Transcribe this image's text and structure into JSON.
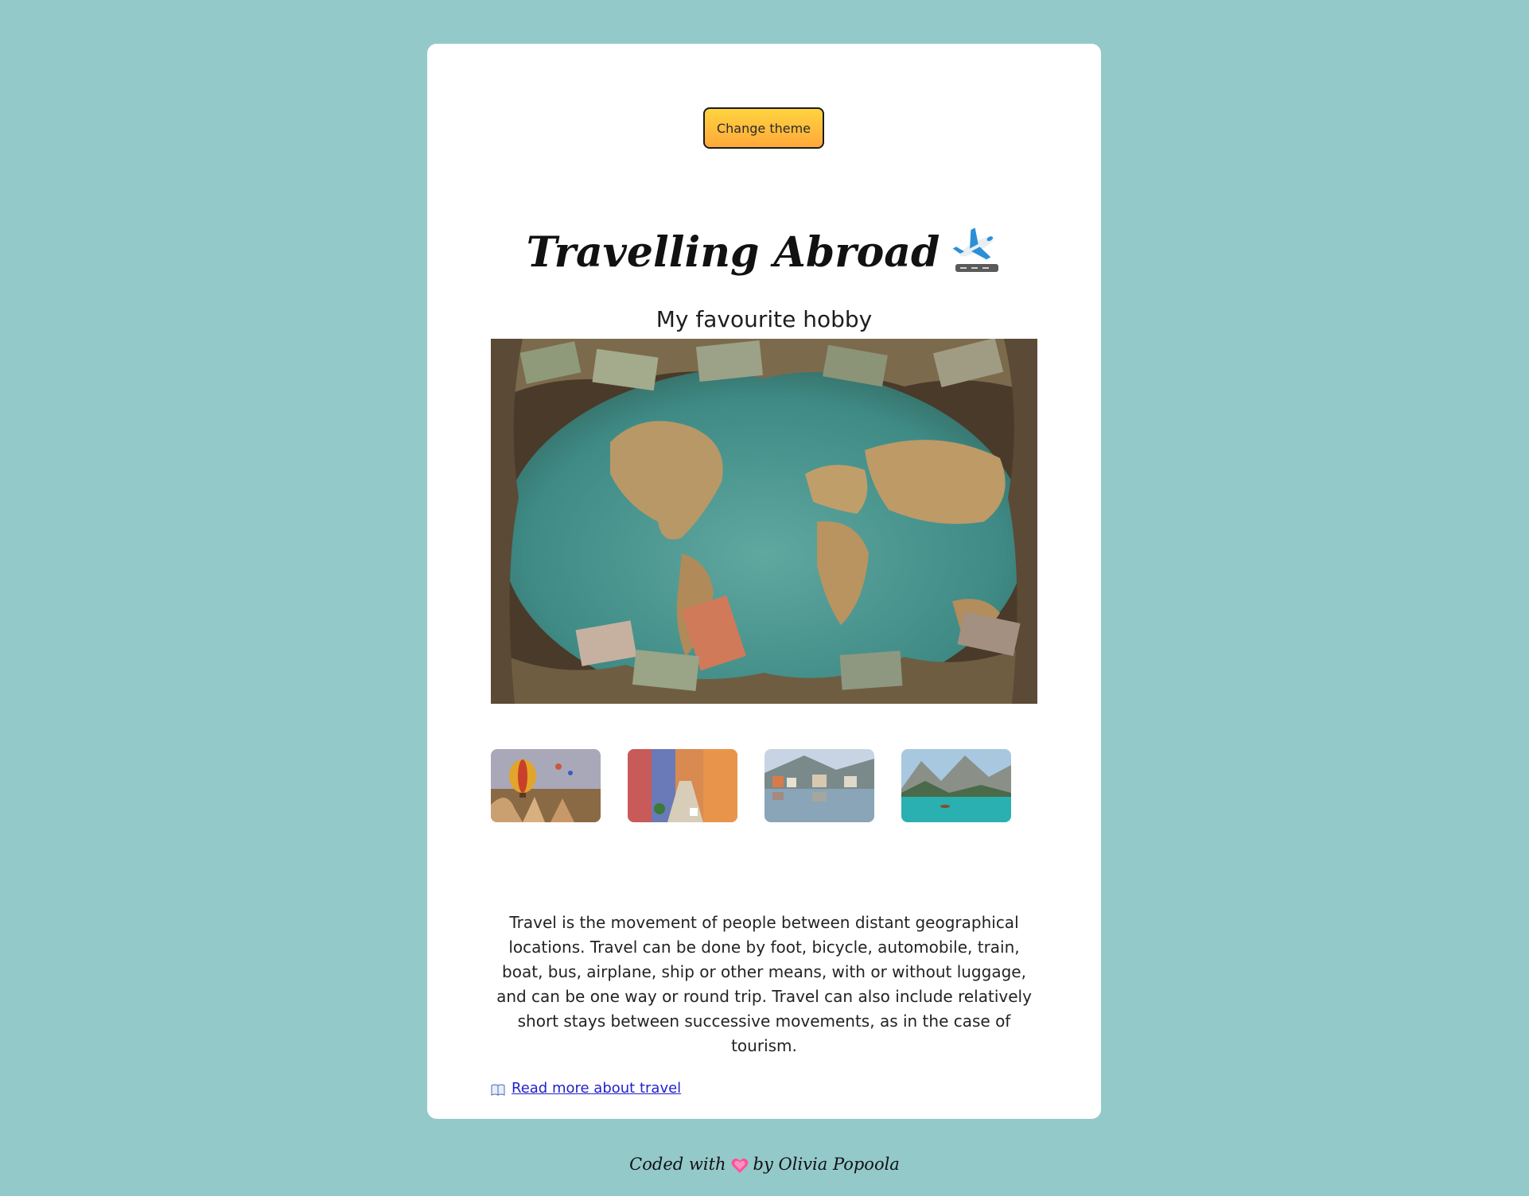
{
  "theme": {
    "page_background": "#94c9ca",
    "card_background": "#ffffff",
    "button_gradient_top": "#ffd43f",
    "button_gradient_bottom": "#ffa83a",
    "link_color": "#2222cc"
  },
  "header": {
    "theme_button_label": "Change theme",
    "title": "Travelling Abroad",
    "title_icon": "airplane-departure-icon",
    "subtitle": "My favourite hobby"
  },
  "gallery": {
    "hero_image": "world-map-with-money",
    "thumbnails": [
      {
        "name": "hot-air-balloons"
      },
      {
        "name": "colorful-street"
      },
      {
        "name": "lakeside-town"
      },
      {
        "name": "mountain-lake"
      }
    ]
  },
  "content": {
    "description": "Travel is the movement of people between distant geographical locations. Travel can be done by foot, bicycle, automobile, train, boat, bus, airplane, ship or other means, with or without luggage, and can be one way or round trip. Travel can also include relatively short stays between successive movements, as in the case of tourism.",
    "read_more_icon": "open-book-icon",
    "read_more_label": "Read more about travel"
  },
  "footer": {
    "prefix": "Coded with",
    "heart_icon": "heart-icon",
    "suffix": "by Olivia Popoola"
  }
}
